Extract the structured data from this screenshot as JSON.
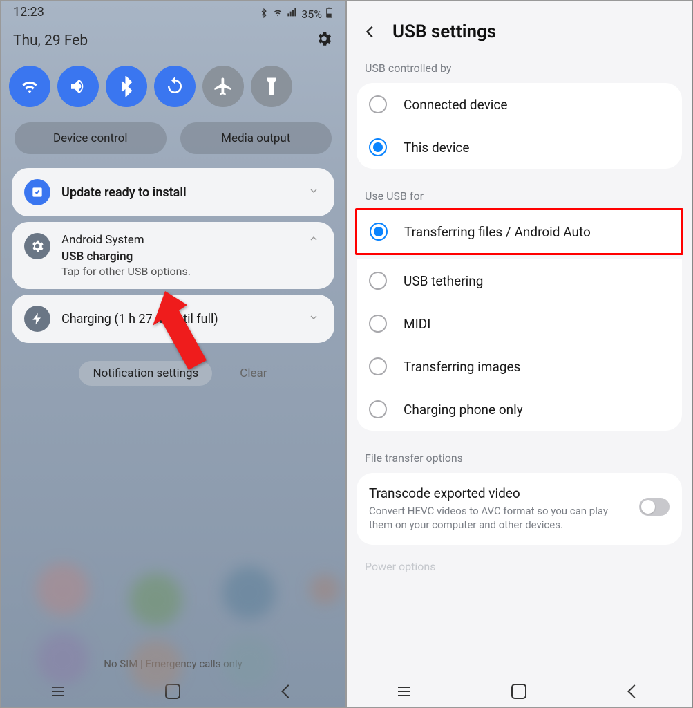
{
  "left": {
    "status_time": "12:23",
    "status_battery": "35%",
    "date": "Thu, 29 Feb",
    "qs_buttons": {
      "device_control": "Device control",
      "media_output": "Media output"
    },
    "notifications": {
      "update": {
        "title": "Update ready to install"
      },
      "usb": {
        "app": "Android System",
        "title": "USB charging",
        "desc": "Tap for other USB options."
      },
      "charging": {
        "title": "Charging (1 h 27 m until full)"
      }
    },
    "notif_settings": "Notification settings",
    "clear": "Clear",
    "bottom_info": "No SIM | Emergency calls only"
  },
  "right": {
    "title": "USB settings",
    "section_controlled": "USB controlled by",
    "controlled_options": {
      "connected_device": "Connected device",
      "this_device": "This device"
    },
    "section_use": "Use USB for",
    "use_options": {
      "transfer_files": "Transferring files / Android Auto",
      "usb_tethering": "USB tethering",
      "midi": "MIDI",
      "transfer_images": "Transferring images",
      "charging_only": "Charging phone only"
    },
    "section_file_transfer": "File transfer options",
    "transcode": {
      "title": "Transcode exported video",
      "desc": "Convert HEVC videos to AVC format so you can play them on your computer and other devices."
    },
    "section_power_cut": "Power options"
  }
}
